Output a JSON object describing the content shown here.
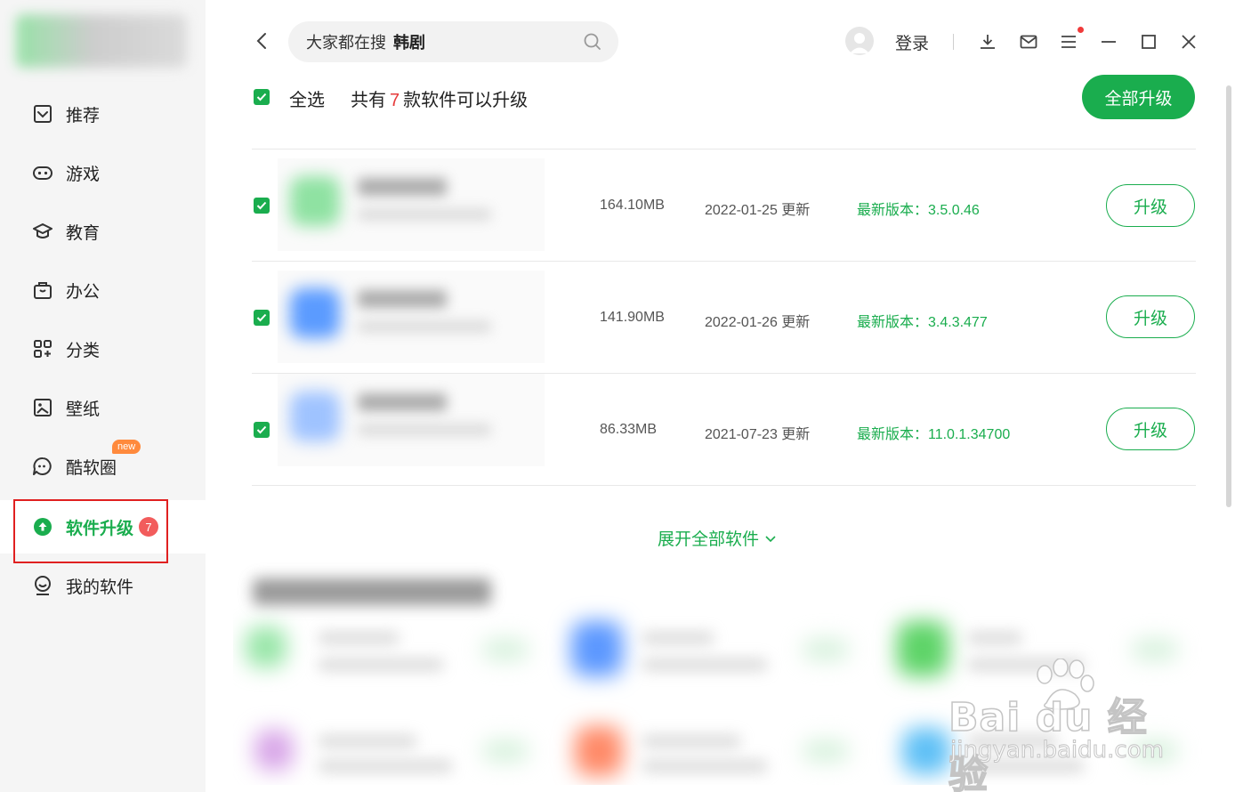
{
  "sidebar": {
    "items": [
      {
        "id": "recommend",
        "label": "推荐",
        "icon": "recommend-icon"
      },
      {
        "id": "games",
        "label": "游戏",
        "icon": "gamepad-icon"
      },
      {
        "id": "education",
        "label": "教育",
        "icon": "graduation-cap-icon"
      },
      {
        "id": "office",
        "label": "办公",
        "icon": "briefcase-icon"
      },
      {
        "id": "category",
        "label": "分类",
        "icon": "category-grid-icon"
      },
      {
        "id": "wallpaper",
        "label": "壁纸",
        "icon": "picture-icon"
      },
      {
        "id": "cool-circle",
        "label": "酷软圈",
        "icon": "chat-bubble-icon",
        "badge": "new"
      },
      {
        "id": "software-upgrade",
        "label": "软件升级",
        "icon": "upgrade-arrow-icon",
        "badge_count": "7",
        "active": true
      },
      {
        "id": "my-software",
        "label": "我的软件",
        "icon": "user-face-icon"
      }
    ]
  },
  "topbar": {
    "search_prefix": "大家都在搜",
    "search_keyword": "韩剧",
    "login_label": "登录"
  },
  "list_header": {
    "select_all_label": "全选",
    "count_prefix": "共有",
    "count": "7",
    "count_suffix": "款软件可以升级",
    "upgrade_all_label": "全部升级"
  },
  "rows": [
    {
      "size": "164.10MB",
      "date": "2022-01-25 更新",
      "version": "最新版本：3.5.0.46",
      "button": "升级",
      "checked": true,
      "icon_color": "#8fe2a2"
    },
    {
      "size": "141.90MB",
      "date": "2022-01-26 更新",
      "version": "最新版本：3.4.3.477",
      "button": "升级",
      "checked": true,
      "icon_color": "#5b9bff"
    },
    {
      "size": "86.33MB",
      "date": "2021-07-23 更新",
      "version": "最新版本：11.0.1.34700",
      "button": "升级",
      "checked": true,
      "icon_color": "#9fc3ff"
    }
  ],
  "expand_label": "展开全部软件",
  "watermark": {
    "line1": "Bai du 经验",
    "line2": "jingyan.baidu.com"
  },
  "colors": {
    "accent": "#1aad4e",
    "badge_red": "#f25c5c",
    "new_badge": "#ff8a3d",
    "highlight_box": "#e02020"
  }
}
